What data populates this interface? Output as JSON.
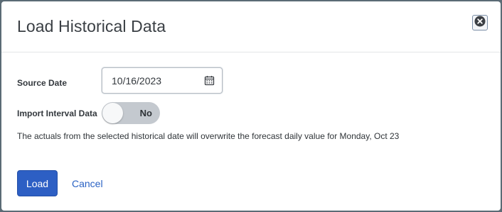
{
  "dialog": {
    "title": "Load Historical Data",
    "close_icon": "close-icon"
  },
  "form": {
    "source_date_label": "Source Date",
    "source_date_value": "10/16/2023",
    "calendar_icon": "calendar-icon",
    "import_interval_label": "Import Interval Data",
    "import_interval_toggle": "No",
    "info_text": "The actuals from the selected historical date will overwrite the forecast daily value for Monday, Oct 23"
  },
  "actions": {
    "load_label": "Load",
    "cancel_label": "Cancel"
  },
  "colors": {
    "primary": "#2d5fc4",
    "link": "#2a62c4",
    "toggle_off": "#c4c9cf"
  }
}
